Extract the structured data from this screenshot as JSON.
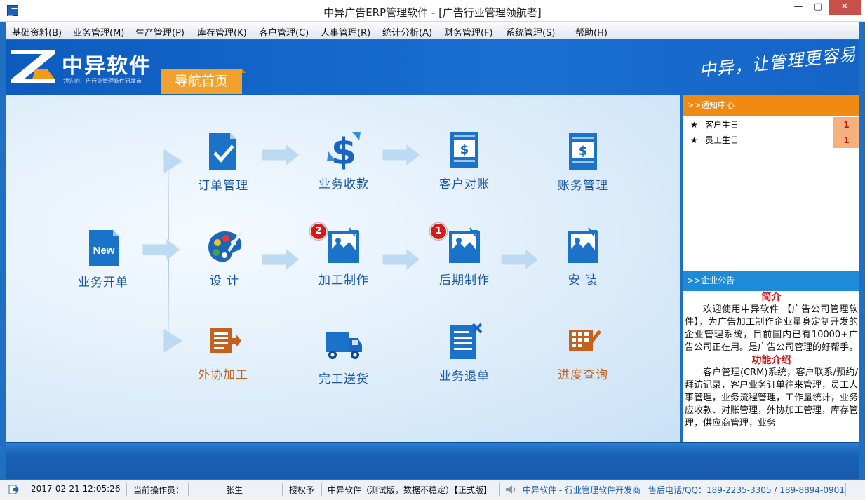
{
  "window": {
    "title": "中异广告ERP管理软件 - [广告行业管理领航者]",
    "min_glyph": "—",
    "max_glyph": "▢",
    "close_glyph": "✕"
  },
  "menu": [
    "基础资料(B)",
    "业务管理(M)",
    "生产管理(P)",
    "库存管理(K)",
    "客户管理(C)",
    "人事管理(R)",
    "统计分析(A)",
    "财务管理(F)",
    "系统管理(S)",
    "帮助(H)"
  ],
  "banner": {
    "logo_title": "中异软件",
    "logo_sub": "领先的广告行业管理软件研发商",
    "nav_tab": "导航首页",
    "slogan": "中异，让管理更容易"
  },
  "flow": {
    "start": "业务开单",
    "row1": [
      "订单管理",
      "业务收款",
      "客户对账",
      "账务管理"
    ],
    "row2": [
      "设  计",
      "加工制作",
      "后期制作",
      "安  装"
    ],
    "row3": [
      "外协加工",
      "完工送货",
      "业务退单",
      "进度查询"
    ],
    "new_icon_text": "New",
    "badges": {
      "processing": "2",
      "post": "1"
    }
  },
  "notice": {
    "header": ">>通知中心",
    "items": [
      {
        "star": "★",
        "label": "客户生日",
        "count": "1"
      },
      {
        "star": "★",
        "label": "员工生日",
        "count": "1"
      }
    ]
  },
  "bulletin": {
    "header": ">>企业公告",
    "intro_title": "简介",
    "intro_text": "欢迎使用中异软件 【广告公司管理软件】，为广告加工制作企业量身定制开发的企业管理系统，目前国内已有10000+广告公司正在用。是广告公司管理的好帮手。",
    "func_title": "功能介绍",
    "func_text": "客户管理(CRM)系统，客户联系/预约/拜访记录，客户业务订单往来管理，员工人事管理，业务流程管理，工作量统计，业务应收款、对账管理，外协加工管理，库存管理，供应商管理，业务"
  },
  "status": {
    "datetime": "2017-02-21 12:05:26",
    "operator_label": "当前操作员：",
    "operator": "张生",
    "license_label": "授权予",
    "license": "中异软件（测试版，数据不稳定）【正式版】",
    "company": "中异软件 - 行业管理软件开发商",
    "hotline": "售后电话/QQ：189-2235-3305  / 189-8894-0901"
  },
  "colors": {
    "brand_blue": "#1f6fc3",
    "accent_orange": "#f1a12d",
    "notice_orange": "#f08a12",
    "bulletin_blue": "#1e8bd8",
    "badge_red": "#d21c1c"
  }
}
